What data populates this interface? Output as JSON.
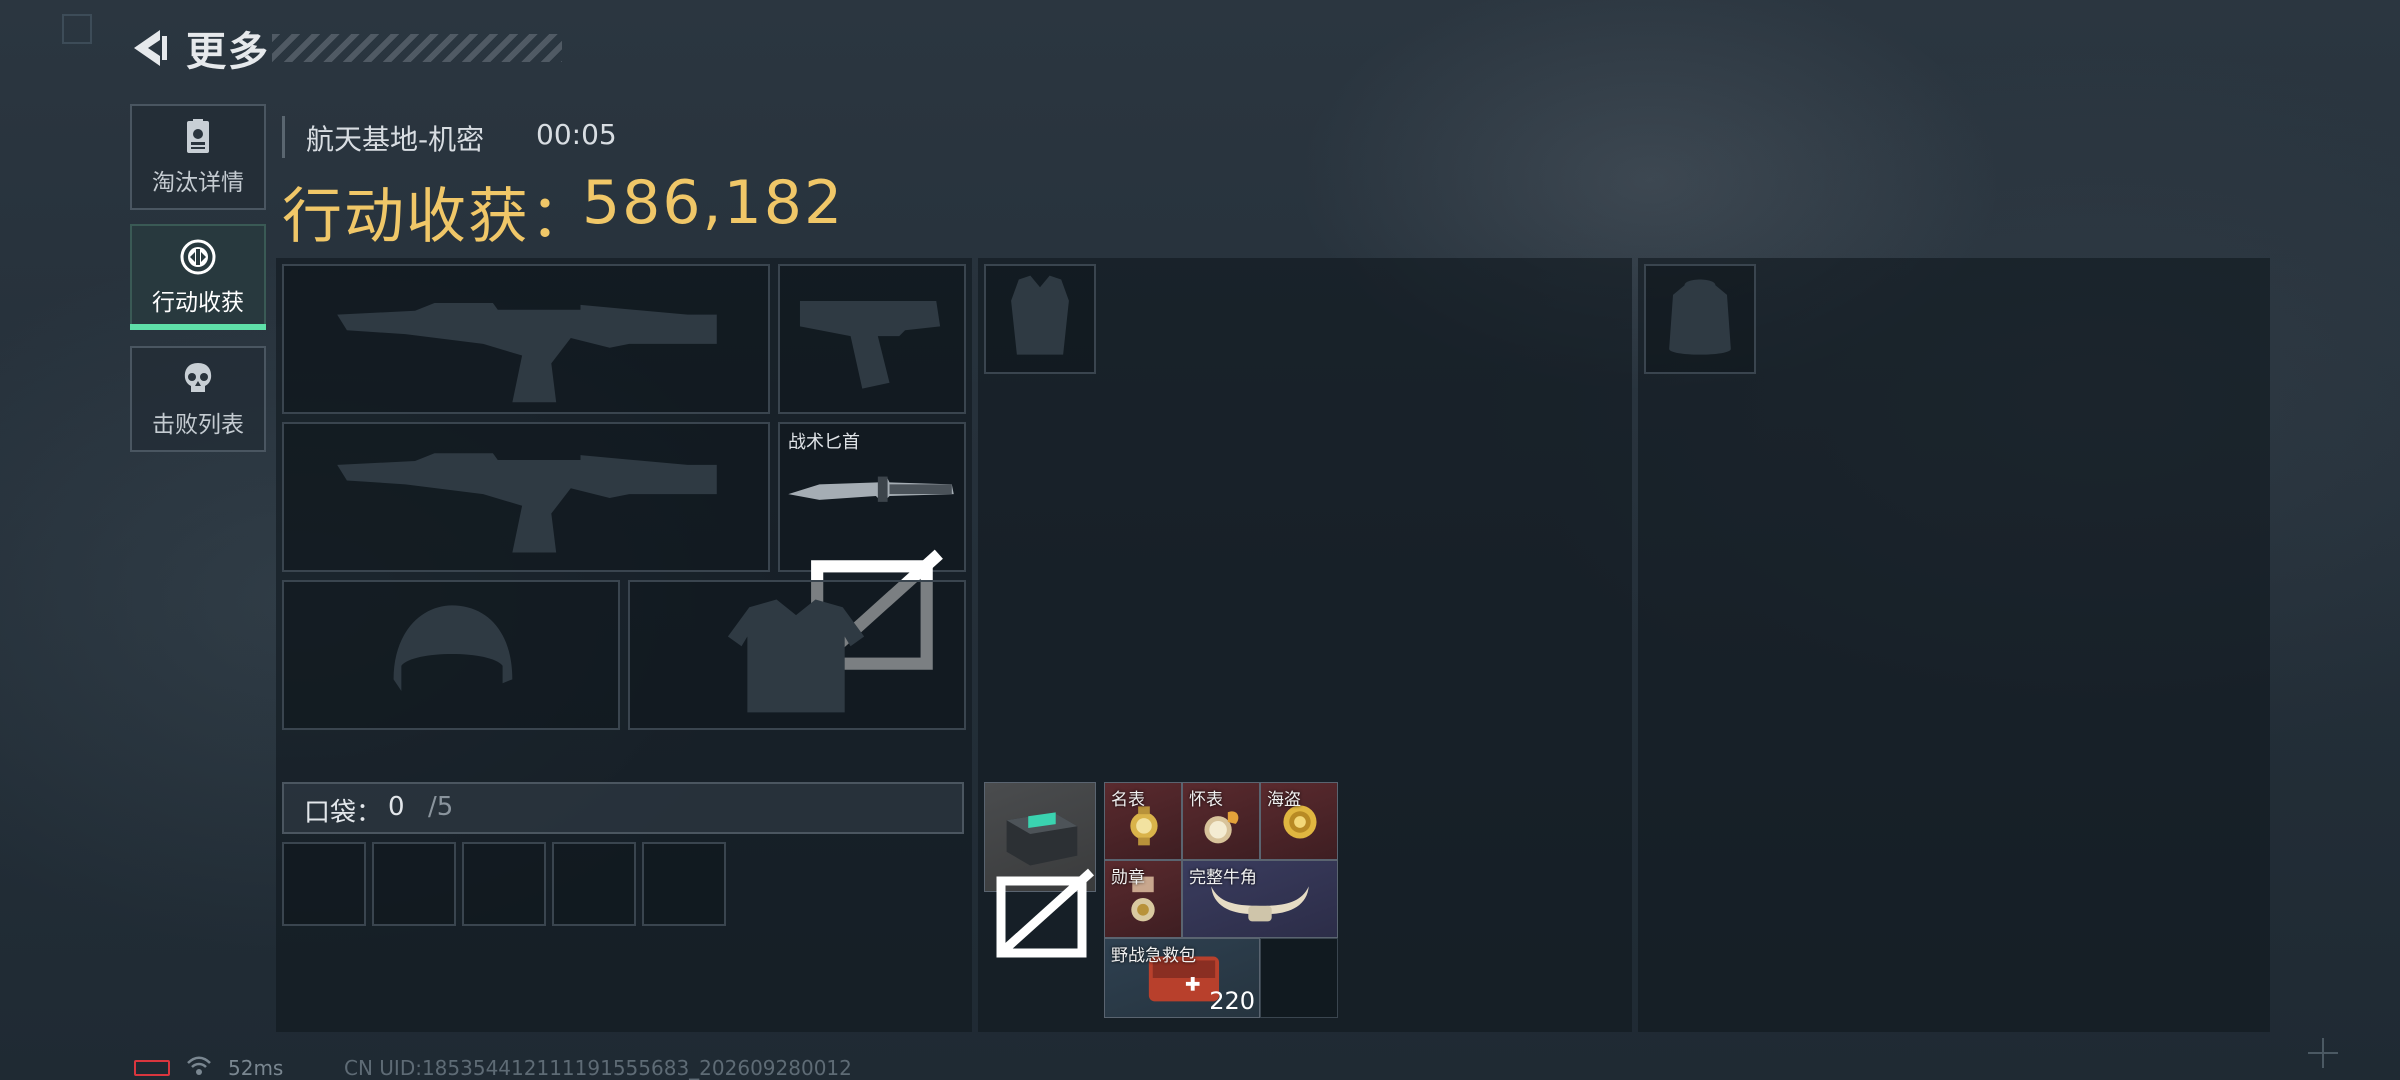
{
  "header": {
    "back_title": "更多"
  },
  "sidebar": {
    "items": [
      {
        "label": "淘汰详情",
        "icon": "id-card-icon",
        "active": false
      },
      {
        "label": "行动收获",
        "icon": "loot-coin-icon",
        "active": true
      },
      {
        "label": "击败列表",
        "icon": "skull-icon",
        "active": false
      }
    ]
  },
  "match": {
    "map": "航天基地-机密",
    "time": "00:05"
  },
  "loot": {
    "label": "行动收获：",
    "value": "586,182"
  },
  "equipment": {
    "primary_weapon_1": "rifle-silhouette-icon",
    "pistol": "pistol-silhouette-icon",
    "primary_weapon_2": "rifle-silhouette-icon",
    "knife_label": "战术匕首",
    "helmet": "helmet-silhouette-icon",
    "armor": "armor-silhouette-icon",
    "chest_rig": "chest-rig-silhouette-icon",
    "backpack": "backpack-silhouette-icon"
  },
  "pocket": {
    "label": "口袋：",
    "count": "0",
    "max": "/5"
  },
  "items": [
    {
      "name": "名表",
      "rarity": "red"
    },
    {
      "name": "怀表",
      "rarity": "red"
    },
    {
      "name": "海盗",
      "rarity": "red"
    },
    {
      "name": "勋章",
      "rarity": "red"
    },
    {
      "name": "完整牛角",
      "rarity": "purple"
    },
    {
      "name": "野战急救包",
      "rarity": "blue",
      "count": "220"
    }
  ],
  "footer": {
    "ping": "52ms",
    "uid": "CN UID:185354412111191555683_202609280012"
  },
  "colors": {
    "accent": "#5ee0a8",
    "loot_gold": "#f0c768",
    "red_rarity": "#5a2a2e",
    "purple_rarity": "#3a3c5e"
  }
}
